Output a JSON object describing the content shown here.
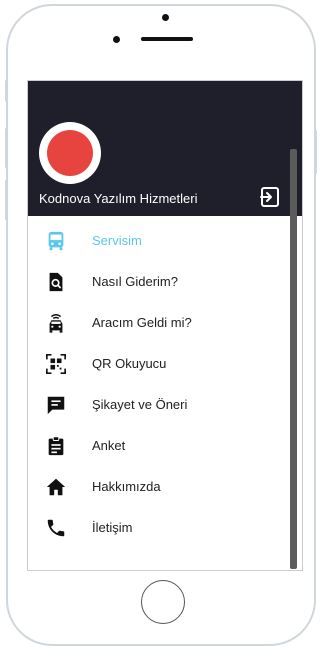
{
  "drawer": {
    "user_name": "Kodnova Yazılım Hizmetleri",
    "logout_icon": "logout-icon"
  },
  "menu": {
    "items": [
      {
        "label": "Servisim",
        "icon": "bus-icon",
        "active": true
      },
      {
        "label": "Nasıl Giderim?",
        "icon": "route-search-icon",
        "active": false
      },
      {
        "label": "Aracım Geldi mi?",
        "icon": "vehicle-arrival-icon",
        "active": false
      },
      {
        "label": "QR Okuyucu",
        "icon": "qr-code-icon",
        "active": false
      },
      {
        "label": "Şikayet ve Öneri",
        "icon": "feedback-icon",
        "active": false
      },
      {
        "label": "Anket",
        "icon": "clipboard-icon",
        "active": false
      },
      {
        "label": "Hakkımızda",
        "icon": "home-icon",
        "active": false
      },
      {
        "label": "İletişim",
        "icon": "phone-icon",
        "active": false
      }
    ]
  },
  "colors": {
    "header_bg": "#1f1f2b",
    "accent": "#5ac8ee",
    "avatar_red": "#e8443f"
  }
}
